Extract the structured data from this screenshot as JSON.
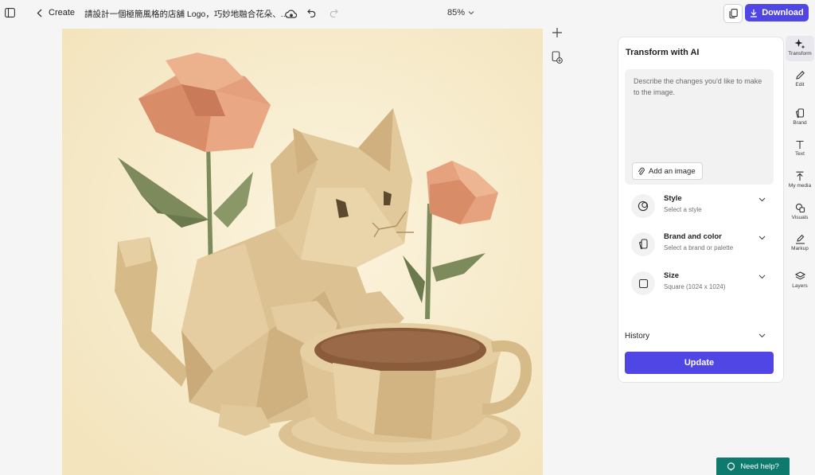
{
  "header": {
    "create_label": "Create",
    "title": "請設計一個極簡風格的店舖 Logo，巧妙地融合花朵、...",
    "zoom": "85%",
    "download_label": "Download"
  },
  "panel": {
    "title": "Transform with AI",
    "prompt_placeholder": "Describe the changes you'd like to make to the image.",
    "add_image_label": "Add an image",
    "options": [
      {
        "title": "Style",
        "subtitle": "Select a style",
        "icon": "style-icon"
      },
      {
        "title": "Brand and color",
        "subtitle": "Select a brand or palette",
        "icon": "brand-icon"
      },
      {
        "title": "Size",
        "subtitle": "Square (1024 x 1024)",
        "icon": "square-icon"
      }
    ],
    "history_label": "History",
    "update_label": "Update"
  },
  "rail": {
    "items": [
      {
        "label": "Transform",
        "icon": "sparkle-icon"
      },
      {
        "label": "Edit",
        "icon": "pencil-icon"
      },
      {
        "label": "Brand",
        "icon": "brand-kit-icon"
      },
      {
        "label": "Text",
        "icon": "text-icon"
      },
      {
        "label": "My media",
        "icon": "upload-icon"
      },
      {
        "label": "Visuals",
        "icon": "shapes-icon"
      },
      {
        "label": "Markup",
        "icon": "markup-pen-icon"
      },
      {
        "label": "Layers",
        "icon": "layers-icon"
      }
    ]
  },
  "help": {
    "label": "Need help?"
  },
  "colors": {
    "accent": "#4f46e5",
    "canvas_bg": "#f6ebcc",
    "help_bg": "#0e7a6e"
  }
}
